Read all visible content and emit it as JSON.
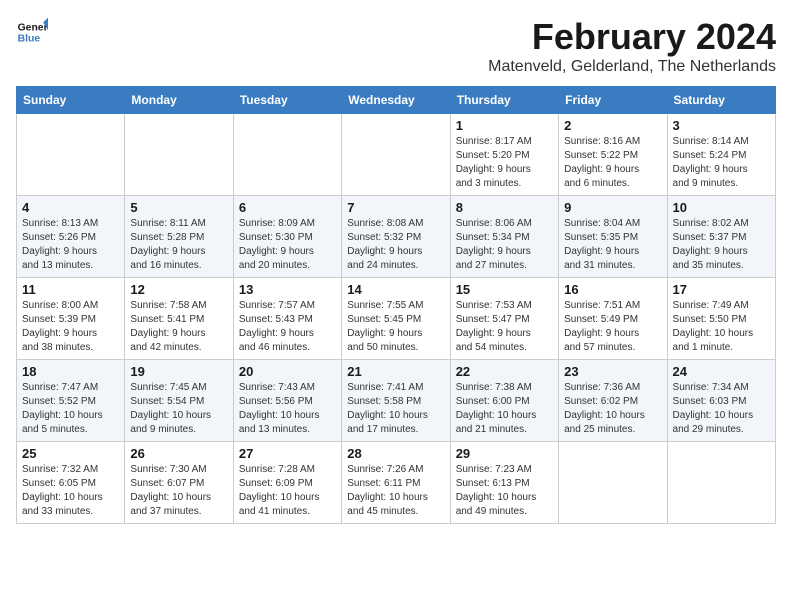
{
  "logo": {
    "line1": "General",
    "line2": "Blue"
  },
  "title": "February 2024",
  "subtitle": "Matenveld, Gelderland, The Netherlands",
  "days": [
    "Sunday",
    "Monday",
    "Tuesday",
    "Wednesday",
    "Thursday",
    "Friday",
    "Saturday"
  ],
  "weeks": [
    [
      {
        "date": "",
        "text": ""
      },
      {
        "date": "",
        "text": ""
      },
      {
        "date": "",
        "text": ""
      },
      {
        "date": "",
        "text": ""
      },
      {
        "date": "1",
        "text": "Sunrise: 8:17 AM\nSunset: 5:20 PM\nDaylight: 9 hours\nand 3 minutes."
      },
      {
        "date": "2",
        "text": "Sunrise: 8:16 AM\nSunset: 5:22 PM\nDaylight: 9 hours\nand 6 minutes."
      },
      {
        "date": "3",
        "text": "Sunrise: 8:14 AM\nSunset: 5:24 PM\nDaylight: 9 hours\nand 9 minutes."
      }
    ],
    [
      {
        "date": "4",
        "text": "Sunrise: 8:13 AM\nSunset: 5:26 PM\nDaylight: 9 hours\nand 13 minutes."
      },
      {
        "date": "5",
        "text": "Sunrise: 8:11 AM\nSunset: 5:28 PM\nDaylight: 9 hours\nand 16 minutes."
      },
      {
        "date": "6",
        "text": "Sunrise: 8:09 AM\nSunset: 5:30 PM\nDaylight: 9 hours\nand 20 minutes."
      },
      {
        "date": "7",
        "text": "Sunrise: 8:08 AM\nSunset: 5:32 PM\nDaylight: 9 hours\nand 24 minutes."
      },
      {
        "date": "8",
        "text": "Sunrise: 8:06 AM\nSunset: 5:34 PM\nDaylight: 9 hours\nand 27 minutes."
      },
      {
        "date": "9",
        "text": "Sunrise: 8:04 AM\nSunset: 5:35 PM\nDaylight: 9 hours\nand 31 minutes."
      },
      {
        "date": "10",
        "text": "Sunrise: 8:02 AM\nSunset: 5:37 PM\nDaylight: 9 hours\nand 35 minutes."
      }
    ],
    [
      {
        "date": "11",
        "text": "Sunrise: 8:00 AM\nSunset: 5:39 PM\nDaylight: 9 hours\nand 38 minutes."
      },
      {
        "date": "12",
        "text": "Sunrise: 7:58 AM\nSunset: 5:41 PM\nDaylight: 9 hours\nand 42 minutes."
      },
      {
        "date": "13",
        "text": "Sunrise: 7:57 AM\nSunset: 5:43 PM\nDaylight: 9 hours\nand 46 minutes."
      },
      {
        "date": "14",
        "text": "Sunrise: 7:55 AM\nSunset: 5:45 PM\nDaylight: 9 hours\nand 50 minutes."
      },
      {
        "date": "15",
        "text": "Sunrise: 7:53 AM\nSunset: 5:47 PM\nDaylight: 9 hours\nand 54 minutes."
      },
      {
        "date": "16",
        "text": "Sunrise: 7:51 AM\nSunset: 5:49 PM\nDaylight: 9 hours\nand 57 minutes."
      },
      {
        "date": "17",
        "text": "Sunrise: 7:49 AM\nSunset: 5:50 PM\nDaylight: 10 hours\nand 1 minute."
      }
    ],
    [
      {
        "date": "18",
        "text": "Sunrise: 7:47 AM\nSunset: 5:52 PM\nDaylight: 10 hours\nand 5 minutes."
      },
      {
        "date": "19",
        "text": "Sunrise: 7:45 AM\nSunset: 5:54 PM\nDaylight: 10 hours\nand 9 minutes."
      },
      {
        "date": "20",
        "text": "Sunrise: 7:43 AM\nSunset: 5:56 PM\nDaylight: 10 hours\nand 13 minutes."
      },
      {
        "date": "21",
        "text": "Sunrise: 7:41 AM\nSunset: 5:58 PM\nDaylight: 10 hours\nand 17 minutes."
      },
      {
        "date": "22",
        "text": "Sunrise: 7:38 AM\nSunset: 6:00 PM\nDaylight: 10 hours\nand 21 minutes."
      },
      {
        "date": "23",
        "text": "Sunrise: 7:36 AM\nSunset: 6:02 PM\nDaylight: 10 hours\nand 25 minutes."
      },
      {
        "date": "24",
        "text": "Sunrise: 7:34 AM\nSunset: 6:03 PM\nDaylight: 10 hours\nand 29 minutes."
      }
    ],
    [
      {
        "date": "25",
        "text": "Sunrise: 7:32 AM\nSunset: 6:05 PM\nDaylight: 10 hours\nand 33 minutes."
      },
      {
        "date": "26",
        "text": "Sunrise: 7:30 AM\nSunset: 6:07 PM\nDaylight: 10 hours\nand 37 minutes."
      },
      {
        "date": "27",
        "text": "Sunrise: 7:28 AM\nSunset: 6:09 PM\nDaylight: 10 hours\nand 41 minutes."
      },
      {
        "date": "28",
        "text": "Sunrise: 7:26 AM\nSunset: 6:11 PM\nDaylight: 10 hours\nand 45 minutes."
      },
      {
        "date": "29",
        "text": "Sunrise: 7:23 AM\nSunset: 6:13 PM\nDaylight: 10 hours\nand 49 minutes."
      },
      {
        "date": "",
        "text": ""
      },
      {
        "date": "",
        "text": ""
      }
    ]
  ]
}
